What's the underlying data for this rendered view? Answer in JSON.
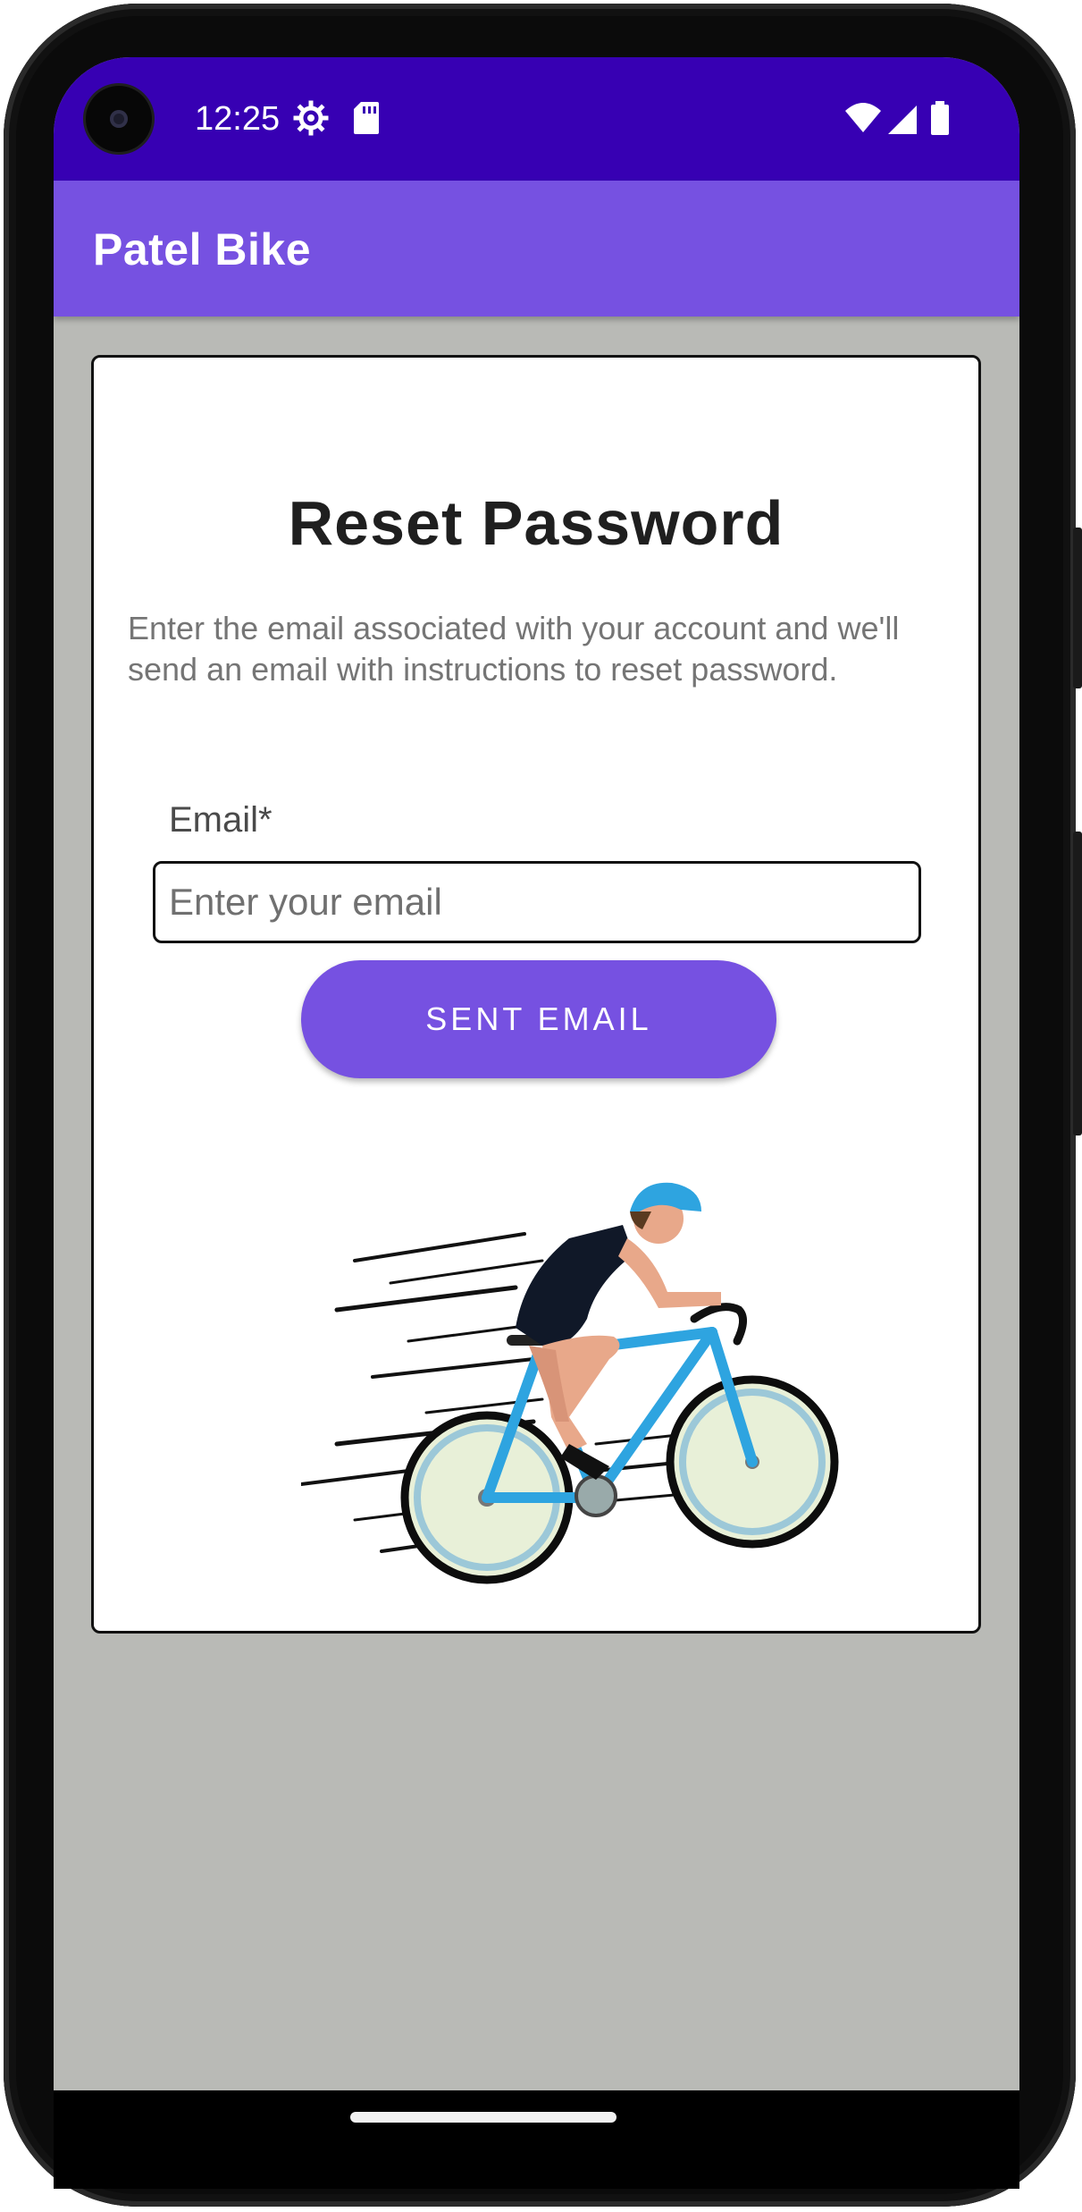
{
  "status_bar": {
    "time": "12:25",
    "icons": [
      "settings-gear-icon",
      "sd-card-icon",
      "wifi-icon",
      "cell-signal-icon",
      "battery-icon"
    ],
    "background": "#3700b3"
  },
  "app_bar": {
    "title": "Patel Bike",
    "background": "#7651e1"
  },
  "reset_card": {
    "heading": "Reset Password",
    "description": "Enter the email associated with your account and we'll send an email with instructions to reset password.",
    "email_label": "Email*",
    "email_value": "",
    "email_placeholder": "Enter your email",
    "button_label": "SENT EMAIL",
    "accent": "#7651e1",
    "illustration": "cyclist-illustration"
  },
  "screen_background": "#b9bab6"
}
